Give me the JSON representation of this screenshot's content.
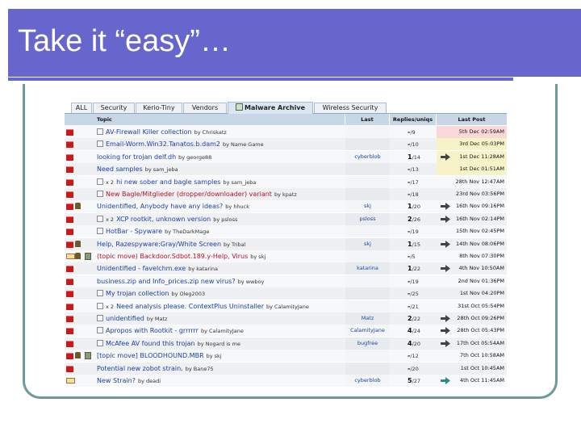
{
  "slide": {
    "title": "Take it “easy”…"
  },
  "forum": {
    "tabs": [
      {
        "label": "ALL",
        "active": false
      },
      {
        "label": "Security",
        "active": false
      },
      {
        "label": "Kerio-Tiny",
        "active": false
      },
      {
        "label": "Vendors",
        "active": false
      },
      {
        "label": "Malware Archive",
        "active": true
      },
      {
        "label": "Wireless Security",
        "active": false
      }
    ],
    "columns": {
      "topic": "Topic",
      "last": "Last",
      "replies": "Replies/uniqs",
      "last_post": "Last Post"
    },
    "rows": [
      {
        "icons": [
          "flag"
        ],
        "topic_icon": "doc",
        "title": "AV-Firewall Killer collection",
        "author": "by Chriskatz",
        "color": "blue",
        "last": "",
        "replies": "-",
        "uniqs": "9",
        "arrow": false,
        "post": "5th Dec 02:59AM",
        "hl": "red"
      },
      {
        "icons": [
          "flag"
        ],
        "topic_icon": "doc",
        "title": "Email-Worm.Win32.Tanatos.b.dam2",
        "author": "by Name Game",
        "color": "blue",
        "last": "",
        "replies": "-",
        "uniqs": "10",
        "arrow": false,
        "post": "3rd Dec 05:03PM",
        "hl": "yellow"
      },
      {
        "icons": [
          "flag"
        ],
        "topic_icon": "",
        "title": "looking for trojan delf.dh",
        "author": "by george88",
        "color": "blue",
        "last": "cyberblob",
        "replies": "1",
        "uniqs": "14",
        "arrow": true,
        "post": "1st Dec 11:28AM",
        "hl": "yellow"
      },
      {
        "icons": [
          "flag"
        ],
        "topic_icon": "",
        "title": "Need samples",
        "author": "by sam_jeba",
        "color": "blue",
        "last": "",
        "replies": "-",
        "uniqs": "13",
        "arrow": false,
        "post": "1st Dec 01:51AM",
        "hl": "yellow"
      },
      {
        "icons": [
          "flag"
        ],
        "topic_icon": "doc",
        "x2": "x 2",
        "title": "hi new sober and bagle samples",
        "author": "by sam_jeba",
        "color": "blue",
        "last": "",
        "replies": "-",
        "uniqs": "17",
        "arrow": false,
        "post": "28th Nov 12:47AM",
        "hl": ""
      },
      {
        "icons": [
          "flag"
        ],
        "topic_icon": "doc",
        "title": "New Bagle/Mitglieder (dropper/downloader) variant",
        "author": "by kpatz",
        "color": "red",
        "last": "",
        "replies": "-",
        "uniqs": "18",
        "arrow": false,
        "post": "23rd Nov 03:56PM",
        "hl": ""
      },
      {
        "icons": [
          "flag",
          "lock"
        ],
        "topic_icon": "",
        "title": "Unidentified, Anybody have any ideas?",
        "author": "by hhuck",
        "color": "blue",
        "last": "skj",
        "replies": "1",
        "uniqs": "20",
        "arrow": true,
        "post": "16th Nov 09:16PM",
        "hl": ""
      },
      {
        "icons": [
          "flag"
        ],
        "topic_icon": "doc",
        "x2": "x 2",
        "title": "XCP rootkit, unknown version",
        "author": "by psloss",
        "color": "blue",
        "last": "psloss",
        "replies": "2",
        "uniqs": "26",
        "arrow": true,
        "post": "16th Nov 02:14PM",
        "hl": ""
      },
      {
        "icons": [
          "flag"
        ],
        "topic_icon": "doc",
        "title": "HotBar - Spyware",
        "author": "by TheDarkMage",
        "color": "blue",
        "last": "",
        "replies": "-",
        "uniqs": "19",
        "arrow": false,
        "post": "15th Nov 02:45PM",
        "hl": ""
      },
      {
        "icons": [
          "flag",
          "lock"
        ],
        "topic_icon": "",
        "title": "Help, Razespyware:Gray/White Screen",
        "author": "by Tribal",
        "color": "blue",
        "last": "skj",
        "replies": "1",
        "uniqs": "15",
        "arrow": true,
        "post": "14th Nov 08:06PM",
        "hl": ""
      },
      {
        "icons": [
          "env",
          "lock",
          "sticky"
        ],
        "topic_icon": "",
        "title": "(topic move) Backdoor.Sdbot.189.y-Help, Virus",
        "author": "by skj",
        "color": "red",
        "last": "",
        "replies": "-",
        "uniqs": "5",
        "arrow": false,
        "post": "8th Nov 07:30PM",
        "hl": ""
      },
      {
        "icons": [
          "flag"
        ],
        "topic_icon": "",
        "title": "Unidentified - favelchm.exe",
        "author": "by katarina",
        "color": "blue",
        "last": "katarina",
        "replies": "1",
        "uniqs": "22",
        "arrow": true,
        "post": "4th Nov 10:50AM",
        "hl": ""
      },
      {
        "icons": [
          "flag"
        ],
        "topic_icon": "",
        "title": "business.zip and Info_prices.zip new virus?",
        "author": "by wwboy",
        "color": "blue",
        "last": "",
        "replies": "-",
        "uniqs": "19",
        "arrow": false,
        "post": "2nd Nov 01:36PM",
        "hl": ""
      },
      {
        "icons": [
          "flag"
        ],
        "topic_icon": "doc",
        "title": "My trojan collection",
        "author": "by Oleg2003",
        "color": "blue",
        "last": "",
        "replies": "-",
        "uniqs": "25",
        "arrow": false,
        "post": "1st Nov 04:20PM",
        "hl": ""
      },
      {
        "icons": [
          "flag"
        ],
        "topic_icon": "doc",
        "x2": "x 2",
        "title": "Need analysis please. ContextPlus Uninstaller",
        "author": "by CalamityJane",
        "color": "blue",
        "last": "",
        "replies": "-",
        "uniqs": "21",
        "arrow": false,
        "post": "31st Oct 05:54PM",
        "hl": ""
      },
      {
        "icons": [
          "flag"
        ],
        "topic_icon": "doc",
        "title": "unidentified",
        "author": "by Matz",
        "color": "blue",
        "last": "Matz",
        "replies": "2",
        "uniqs": "22",
        "arrow": true,
        "post": "28th Oct 09:26PM",
        "hl": ""
      },
      {
        "icons": [
          "flag"
        ],
        "topic_icon": "doc",
        "title": "Apropos with Rootkit - grrrrrr",
        "author": "by CalamityJane",
        "color": "blue",
        "last": "CalamityJane",
        "replies": "4",
        "uniqs": "24",
        "arrow": true,
        "post": "28th Oct 05:43PM",
        "hl": ""
      },
      {
        "icons": [
          "flag"
        ],
        "topic_icon": "doc",
        "title": "McAfee AV found this trojan",
        "author": "by Nogard is me",
        "color": "blue",
        "last": "bugfree",
        "replies": "4",
        "uniqs": "20",
        "arrow": true,
        "post": "17th Oct 05:54AM",
        "hl": ""
      },
      {
        "icons": [
          "flag",
          "lock",
          "sticky"
        ],
        "topic_icon": "",
        "title": "[topic move] BLOODHOUND.MBR",
        "author": "by skj",
        "color": "blue",
        "last": "",
        "replies": "-",
        "uniqs": "12",
        "arrow": false,
        "post": "7th Oct 10:58AM",
        "hl": ""
      },
      {
        "icons": [
          "flag"
        ],
        "topic_icon": "",
        "title": "Potential new zobot strain.",
        "author": "by Bane75",
        "color": "blue",
        "last": "",
        "replies": "-",
        "uniqs": "20",
        "arrow": false,
        "post": "1st Oct 10:45AM",
        "hl": ""
      },
      {
        "icons": [
          "env"
        ],
        "topic_icon": "",
        "title": "New Strain?",
        "author": "by deadi",
        "color": "blue",
        "last": "cyberblob",
        "replies": "5",
        "uniqs": "27",
        "arrow": true,
        "post": "4th Oct 11:45AM",
        "hl": "",
        "arrow_color": "teal"
      }
    ]
  },
  "colors": {
    "title_bar": "#6666cc",
    "frame": "#6f9a9a",
    "link": "#1a3fa8",
    "link_red": "#b3122a",
    "flag": "#c8191b"
  }
}
